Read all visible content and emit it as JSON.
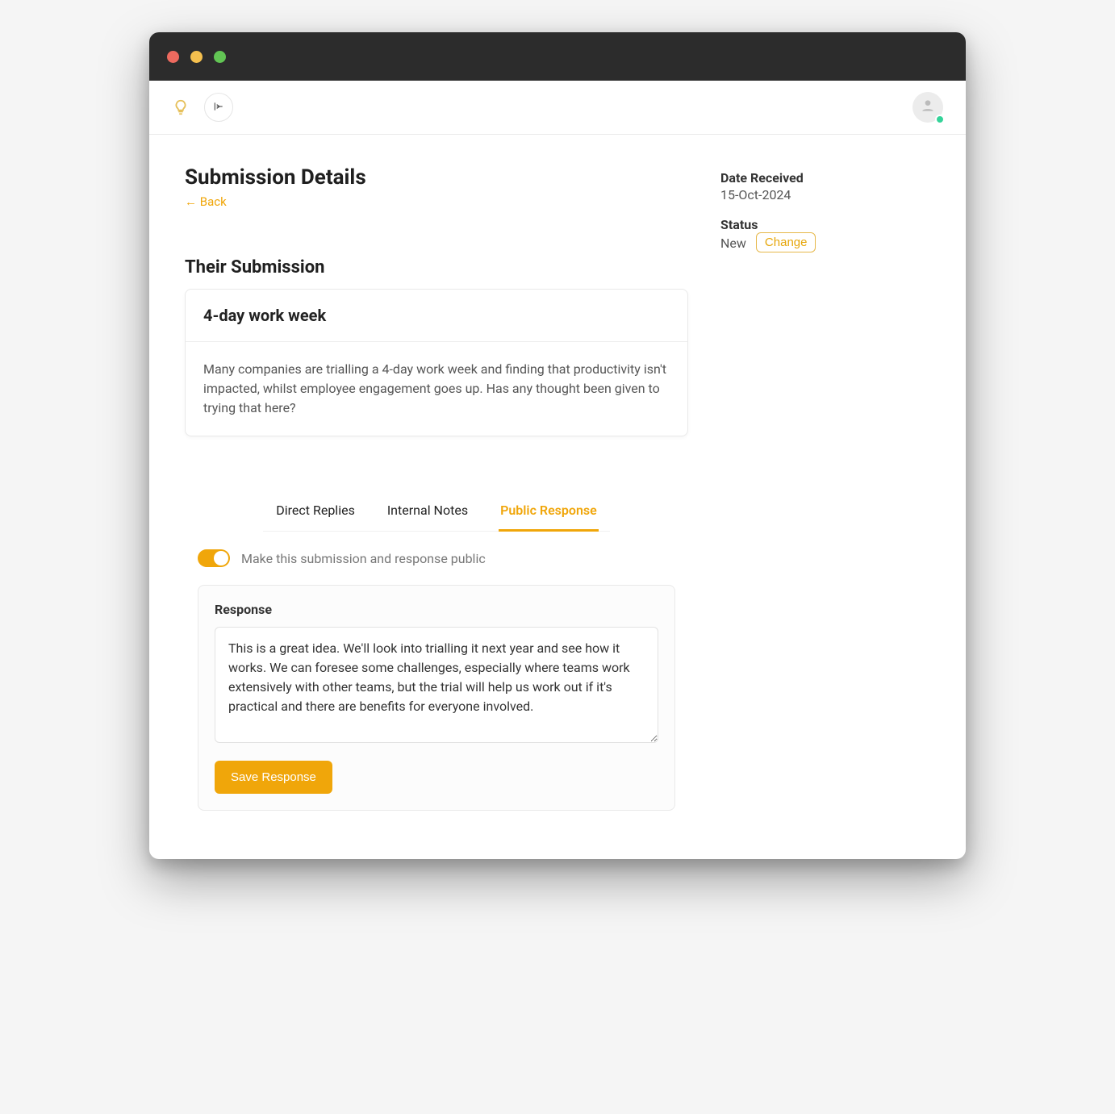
{
  "header": {
    "page_title": "Submission Details",
    "back_label": "← Back"
  },
  "meta": {
    "date_label": "Date Received",
    "date_value": "15-Oct-2024",
    "status_label": "Status",
    "status_value": "New",
    "change_label": "Change"
  },
  "submission": {
    "section_title": "Their Submission",
    "title": "4-day work week",
    "body": "Many companies are trialling a 4-day work week and finding that productivity isn't impacted, whilst employee engagement goes up. Has any thought been given to trying that here?"
  },
  "tabs": {
    "direct_replies": "Direct Replies",
    "internal_notes": "Internal Notes",
    "public_response": "Public Response",
    "active": "public_response"
  },
  "public_response": {
    "toggle_on": true,
    "toggle_label": "Make this submission and response public",
    "response_heading": "Response",
    "response_text": "This is a great idea. We'll look into trialling it next year and see how it works. We can foresee some challenges, especially where teams work extensively with other teams, but the trial will help us work out if it's practical and there are benefits for everyone involved.",
    "save_label": "Save Response"
  },
  "icons": {
    "logo": "lightbulb-icon",
    "expand": "expand-sidebar-icon",
    "avatar": "user-icon"
  },
  "colors": {
    "accent": "#f0a60a",
    "presence": "#34d399"
  }
}
